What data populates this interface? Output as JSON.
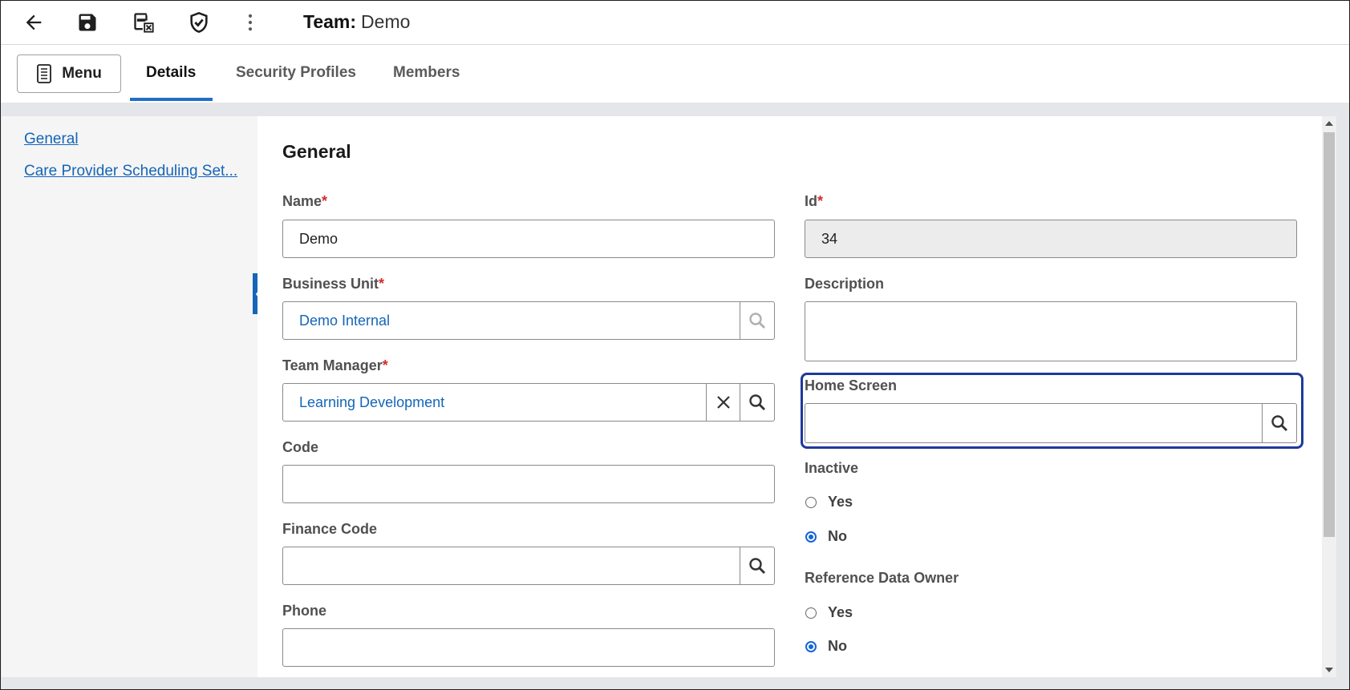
{
  "toolbar": {
    "icons": [
      "back-arrow-icon",
      "save-icon",
      "save-and-close-icon",
      "shield-check-icon",
      "more-vertical-icon"
    ]
  },
  "header": {
    "label": "Team:",
    "value": "Demo"
  },
  "tabs": {
    "menu_label": "Menu",
    "items": [
      "Details",
      "Security Profiles",
      "Members"
    ],
    "active": "Details"
  },
  "leftnav": {
    "items": [
      "General",
      "Care Provider Scheduling Set..."
    ]
  },
  "form": {
    "section_title": "General",
    "required_mark": "*",
    "name": {
      "label": "Name",
      "value": "Demo"
    },
    "id": {
      "label": "Id",
      "value": "34"
    },
    "business_unit": {
      "label": "Business Unit",
      "value": "Demo Internal"
    },
    "description": {
      "label": "Description",
      "value": ""
    },
    "team_manager": {
      "label": "Team Manager",
      "value": "Learning Development"
    },
    "home_screen": {
      "label": "Home Screen",
      "value": ""
    },
    "code": {
      "label": "Code",
      "value": ""
    },
    "inactive": {
      "label": "Inactive",
      "yes": "Yes",
      "no": "No",
      "selected": "No"
    },
    "finance_code": {
      "label": "Finance Code",
      "value": ""
    },
    "reference_data_owner": {
      "label": "Reference Data Owner",
      "yes": "Yes",
      "no": "No",
      "selected": "No"
    },
    "phone": {
      "label": "Phone",
      "value": ""
    }
  },
  "colors": {
    "accent": "#1565b8",
    "required": "#d62a2a",
    "focus": "#1d3a9c"
  }
}
